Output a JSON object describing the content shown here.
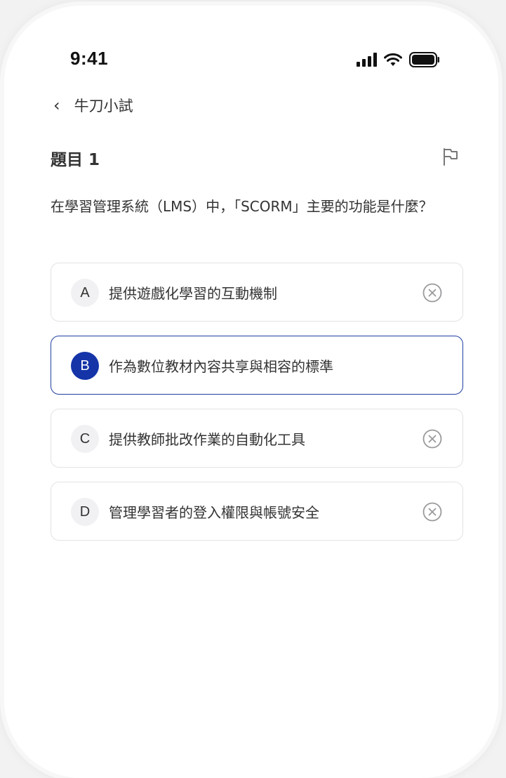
{
  "status_bar": {
    "time": "9:41"
  },
  "nav": {
    "back_label": "牛刀小試"
  },
  "question": {
    "label": "題目 1",
    "text": "在學習管理系統（LMS）中，「SCORM」主要的功能是什麼？"
  },
  "options": [
    {
      "letter": "A",
      "text": "提供遊戲化學習的互動機制",
      "selected": false
    },
    {
      "letter": "B",
      "text": "作為數位教材內容共享與相容的標準",
      "selected": true
    },
    {
      "letter": "C",
      "text": "提供教師批改作業的自動化工具",
      "selected": false
    },
    {
      "letter": "D",
      "text": "管理學習者的登入權限與帳號安全",
      "selected": false
    }
  ],
  "colors": {
    "accent": "#1434a8",
    "selected_border": "#1f3fa0",
    "option_border": "#e3e3e6",
    "text": "#333333"
  },
  "icons": {
    "back": "chevron-left-icon",
    "flag": "flag-icon",
    "eliminate": "circle-x-icon",
    "signal": "cellular-signal-icon",
    "wifi": "wifi-icon",
    "battery": "battery-icon"
  }
}
